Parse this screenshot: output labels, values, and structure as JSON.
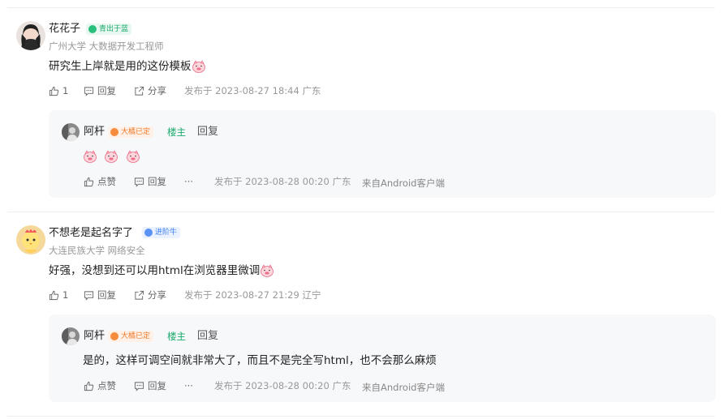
{
  "comments": [
    {
      "user": "花花子",
      "badge": "青出于蓝",
      "school": "广州大学 大数据开发工程师",
      "text": "研究生上岸就是用的这份模板",
      "like_count": "1",
      "reply_label": "回复",
      "share_label": "分享",
      "time": "发布于 2023-08-27 18:44 广东",
      "reply": {
        "user": "阿杆",
        "badge": "大橘已定",
        "owner_tag": "楼主",
        "reply_tag": "回复",
        "text": "",
        "like_label": "点赞",
        "reply_label": "回复",
        "more": "···",
        "time": "发布于 2023-08-28 00:20 广东",
        "source": "来自Android客户端"
      }
    },
    {
      "user": "不想老是起名字了",
      "badge": "进阶牛",
      "school": "大连民族大学 网络安全",
      "text": "好强，没想到还可以用html在浏览器里微调",
      "like_count": "1",
      "reply_label": "回复",
      "share_label": "分享",
      "time": "发布于 2023-08-27 21:29 辽宁",
      "reply": {
        "user": "阿杆",
        "badge": "大橘已定",
        "owner_tag": "楼主",
        "reply_tag": "回复",
        "text": "是的，这样可调空间就非常大了，而且不是完全写html，也不会那么麻烦",
        "like_label": "点赞",
        "reply_label": "回复",
        "more": "···",
        "time": "发布于 2023-08-28 00:20 广东",
        "source": "来自Android客户端"
      }
    }
  ],
  "colors": {
    "badge_green": "#1aaa6a",
    "badge_orange": "#ee7a2c",
    "badge_blue": "#3c7df0",
    "reply_bg": "#f7f8fa"
  },
  "icons": [
    "thumb-up-icon",
    "comment-icon",
    "share-icon",
    "pig-emoji-icon"
  ]
}
